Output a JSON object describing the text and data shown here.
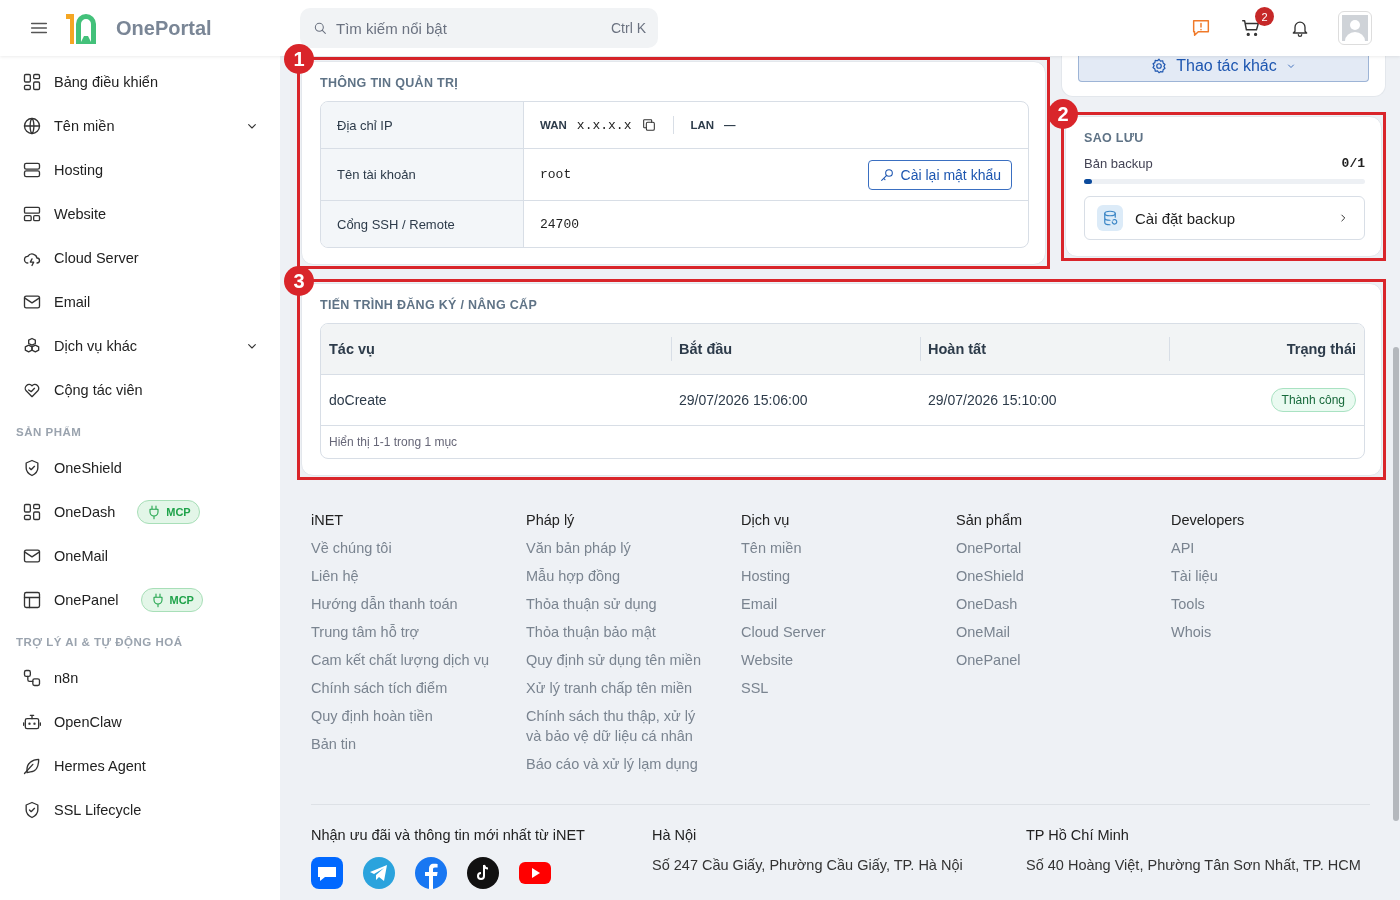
{
  "header": {
    "brand": "OnePortal",
    "search": {
      "placeholder": "Tìm kiếm nổi bật",
      "shortcut": "Ctrl K"
    },
    "cart_badge": "2"
  },
  "sidebar": {
    "sections": [
      {
        "items": [
          {
            "label": "Bảng điều khiển"
          },
          {
            "label": "Tên miền",
            "expanded": false
          },
          {
            "label": "Hosting"
          },
          {
            "label": "Website"
          },
          {
            "label": "Cloud Server"
          },
          {
            "label": "Email"
          },
          {
            "label": "Dịch vụ khác",
            "expanded": false
          },
          {
            "label": "Cộng tác viên"
          }
        ]
      },
      {
        "heading": "SẢN PHẨM",
        "items": [
          {
            "label": "OneShield"
          },
          {
            "label": "OneDash",
            "badge": "MCP"
          },
          {
            "label": "OneMail"
          },
          {
            "label": "OnePanel",
            "badge": "MCP"
          }
        ]
      },
      {
        "heading": "TRỢ LÝ AI & TỰ ĐỘNG HOÁ",
        "items": [
          {
            "label": "n8n"
          },
          {
            "label": "OpenClaw"
          },
          {
            "label": "Hermes Agent"
          },
          {
            "label": "SSL Lifecycle"
          }
        ]
      }
    ]
  },
  "admin_info": {
    "marker": "1",
    "title": "THÔNG TIN QUẢN TRỊ",
    "rows": [
      {
        "kind": "ip",
        "label": "Địa chỉ IP",
        "wan_label": "WAN",
        "wan_value": "x.x.x.x",
        "lan_label": "LAN",
        "lan_value": "—"
      },
      {
        "kind": "text",
        "label": "Tên tài khoản",
        "value": "root",
        "action": "Cài lại mật khẩu"
      },
      {
        "kind": "text",
        "label": "Cổng SSH / Remote",
        "value": "24700"
      }
    ]
  },
  "actions": {
    "label": "Thao tác khác"
  },
  "backup": {
    "marker": "2",
    "title": "SAO LƯU",
    "label": "Bản backup",
    "count": "0/1",
    "level": 0.03,
    "setup": "Cài đặt backup"
  },
  "progress": {
    "marker": "3",
    "title": "TIẾN TRÌNH ĐĂNG KÝ / NÂNG CẤP",
    "columns": [
      "Tác vụ",
      "Bắt đầu",
      "Hoàn tất",
      "Trạng thái"
    ],
    "rows": [
      {
        "cells": [
          "doCreate",
          "29/07/2026 15:06:00",
          "29/07/2026 15:10:00"
        ],
        "status": "Thành công",
        "kind": "success"
      }
    ],
    "summary": "Hiển thị 1-1 trong 1 mục"
  },
  "footer": {
    "columns": [
      {
        "heading": "iNET",
        "links": [
          "Về chúng tôi",
          "Liên hệ",
          "Hướng dẫn thanh toán",
          "Trung tâm hỗ trợ",
          "Cam kết chất lượng dịch vụ",
          "Chính sách tích điểm",
          "Quy định hoàn tiền",
          "Bản tin"
        ]
      },
      {
        "heading": "Pháp lý",
        "links": [
          "Văn bản pháp lý",
          "Mẫu hợp đồng",
          "Thỏa thuận sử dụng",
          "Thỏa thuận bảo mật",
          "Quy định sử dụng tên miền",
          "Xử lý tranh chấp tên miền",
          "Chính sách thu thập, xử lý và bảo vệ dữ liệu cá nhân",
          "Báo cáo và xử lý lạm dụng"
        ]
      },
      {
        "heading": "Dịch vụ",
        "links": [
          "Tên miền",
          "Hosting",
          "Email",
          "Cloud Server",
          "Website",
          "SSL"
        ]
      },
      {
        "heading": "Sản phẩm",
        "links": [
          "OnePortal",
          "OneShield",
          "OneDash",
          "OneMail",
          "OnePanel"
        ]
      },
      {
        "heading": "Developers",
        "links": [
          "API",
          "Tài liệu",
          "Tools",
          "Whois"
        ]
      }
    ],
    "newsletter": "Nhận ưu đãi và thông tin mới nhất từ iNET",
    "offices": [
      {
        "city": "Hà Nội",
        "address": "Số 247 Cầu Giấy, Phường Cầu Giấy, TP. Hà Nội"
      },
      {
        "city": "TP Hồ Chí Minh",
        "address": "Số 40 Hoàng Việt, Phường Tân Sơn Nhất, TP. HCM"
      }
    ]
  }
}
